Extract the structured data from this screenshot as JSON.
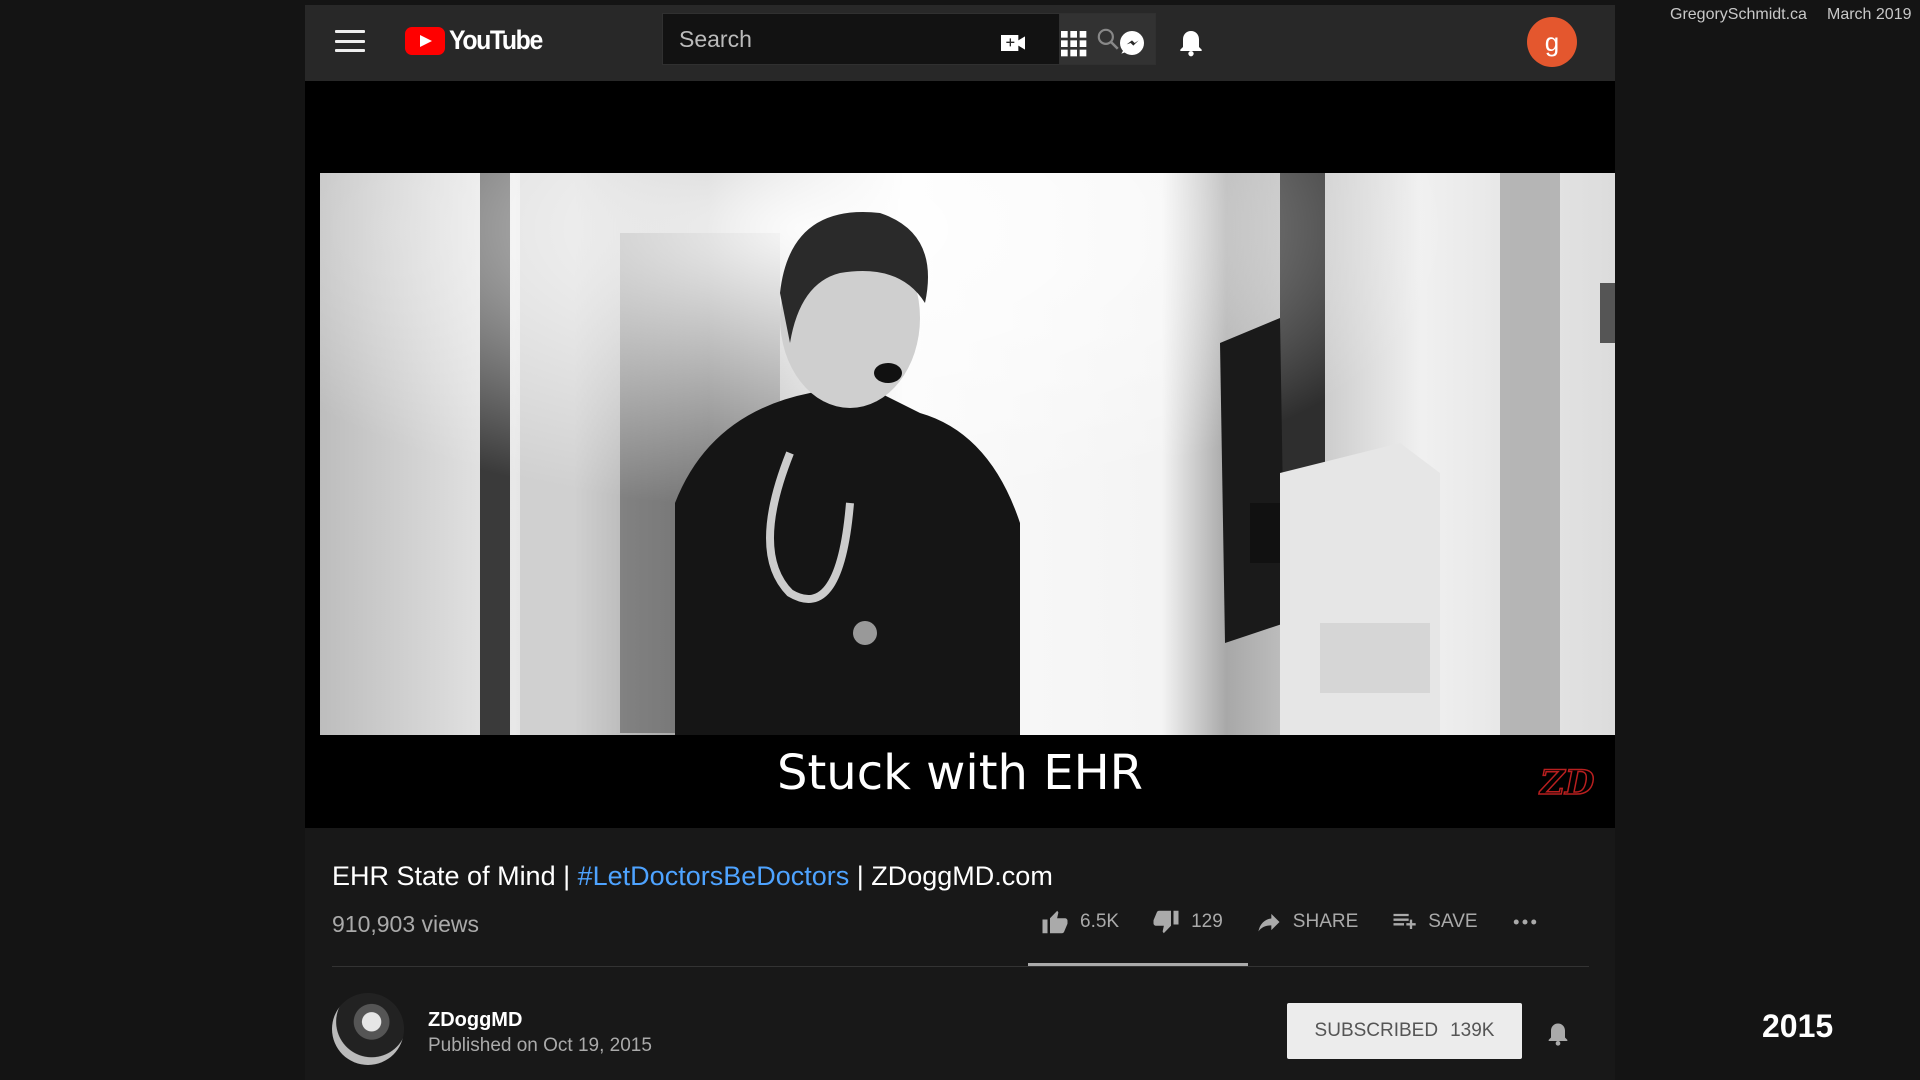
{
  "overlay": {
    "site": "GregorySchmidt.ca",
    "date": "March 2019",
    "year": "2015"
  },
  "header": {
    "logo_text": "YouTube",
    "search_placeholder": "Search",
    "avatar_letter": "g",
    "icons": [
      "menu-icon",
      "youtube-logo",
      "search-icon",
      "create-video-icon",
      "apps-icon",
      "messages-icon",
      "notifications-icon"
    ]
  },
  "player": {
    "caption": "Stuck with EHR",
    "watermark": "ZD"
  },
  "video": {
    "title_prefix": "EHR State of Mind | ",
    "title_hashtag": "#LetDoctorsBeDoctors",
    "title_suffix": " | ZDoggMD.com",
    "views": "910,903 views",
    "likes": "6.5K",
    "dislikes": "129",
    "share_label": "SHARE",
    "save_label": "SAVE",
    "like_ratio": 0.98
  },
  "channel": {
    "name": "ZDoggMD",
    "published": "Published on Oct 19, 2015",
    "subscribe_label": "SUBSCRIBED",
    "subscriber_count": "139K"
  },
  "colors": {
    "brand_red": "#ff0000",
    "hashtag_blue": "#4ea3ff",
    "avatar_orange": "#e4572e"
  }
}
